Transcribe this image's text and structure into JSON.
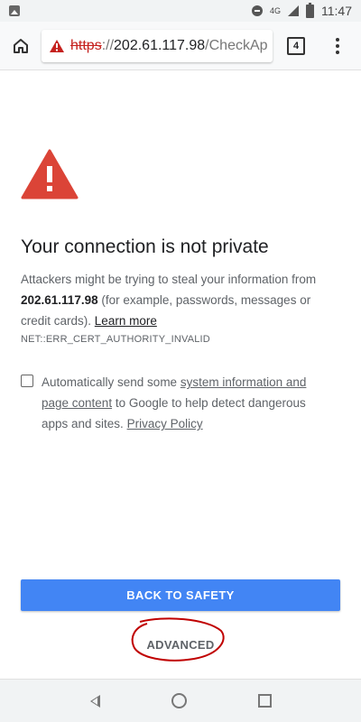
{
  "status_bar": {
    "network": "4G",
    "time": "11:47"
  },
  "toolbar": {
    "url_scheme": "https",
    "url_separator": "://",
    "url_host": "202.61.117.98",
    "url_path": "/CheckAp",
    "tab_count": "4"
  },
  "content": {
    "title": "Your connection is not private",
    "body_prefix": "Attackers might be trying to steal your information from",
    "host_bold": "202.61.117.98",
    "body_suffix": "(for example, passwords, messages or credit cards).",
    "learn_more": "Learn more",
    "error_code": "NET::ERR_CERT_AUTHORITY_INVALID",
    "checkbox_prefix": "Automatically send some",
    "checkbox_link": "system information and page content",
    "checkbox_middle": "to Google to help detect dangerous apps and sites.",
    "privacy_link": "Privacy Policy",
    "checkbox_checked": false
  },
  "buttons": {
    "back_to_safety": "BACK TO SAFETY",
    "advanced": "ADVANCED"
  },
  "colors": {
    "warning_red": "#db4437",
    "primary_blue": "#4285f4",
    "annotation_red": "#c00000"
  }
}
